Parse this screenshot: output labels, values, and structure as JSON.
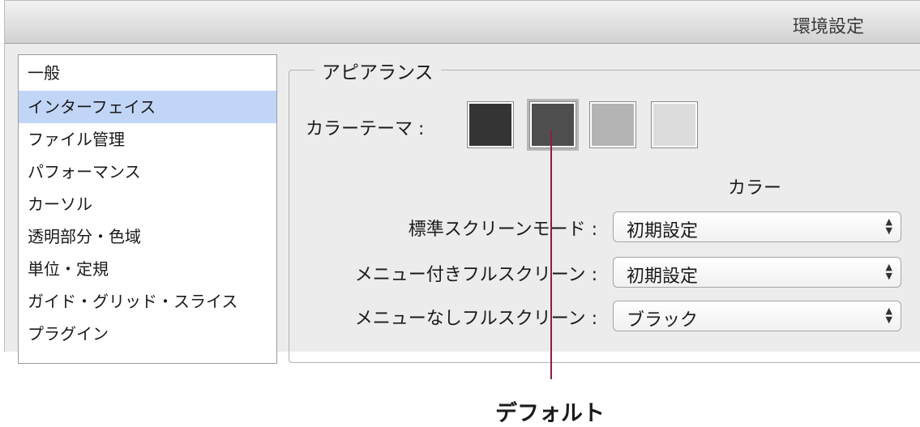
{
  "window": {
    "title": "環境設定"
  },
  "sidebar": {
    "items": [
      {
        "label": "一般"
      },
      {
        "label": "インターフェイス"
      },
      {
        "label": "ファイル管理"
      },
      {
        "label": "パフォーマンス"
      },
      {
        "label": "カーソル"
      },
      {
        "label": "透明部分・色域"
      },
      {
        "label": "単位・定規"
      },
      {
        "label": "ガイド・グリッド・スライス"
      },
      {
        "label": "プラグイン"
      }
    ],
    "selected_label": "インターフェイス"
  },
  "appearance": {
    "group_label": "アピアランス",
    "theme_label": "カラーテーマ :",
    "themes": [
      {
        "color": "#343434"
      },
      {
        "color": "#4e4e4e",
        "selected": true
      },
      {
        "color": "#b4b4b4"
      },
      {
        "color": "#dcdcdc"
      }
    ],
    "color_column_header": "カラー",
    "rows": [
      {
        "label": "標準スクリーンモード :",
        "value": "初期設定"
      },
      {
        "label": "メニュー付きフルスクリーン :",
        "value": "初期設定"
      },
      {
        "label": "メニューなしフルスクリーン :",
        "value": "ブラック"
      }
    ]
  },
  "callout": {
    "text": "デフォルト",
    "color": "#8e1c4c"
  }
}
